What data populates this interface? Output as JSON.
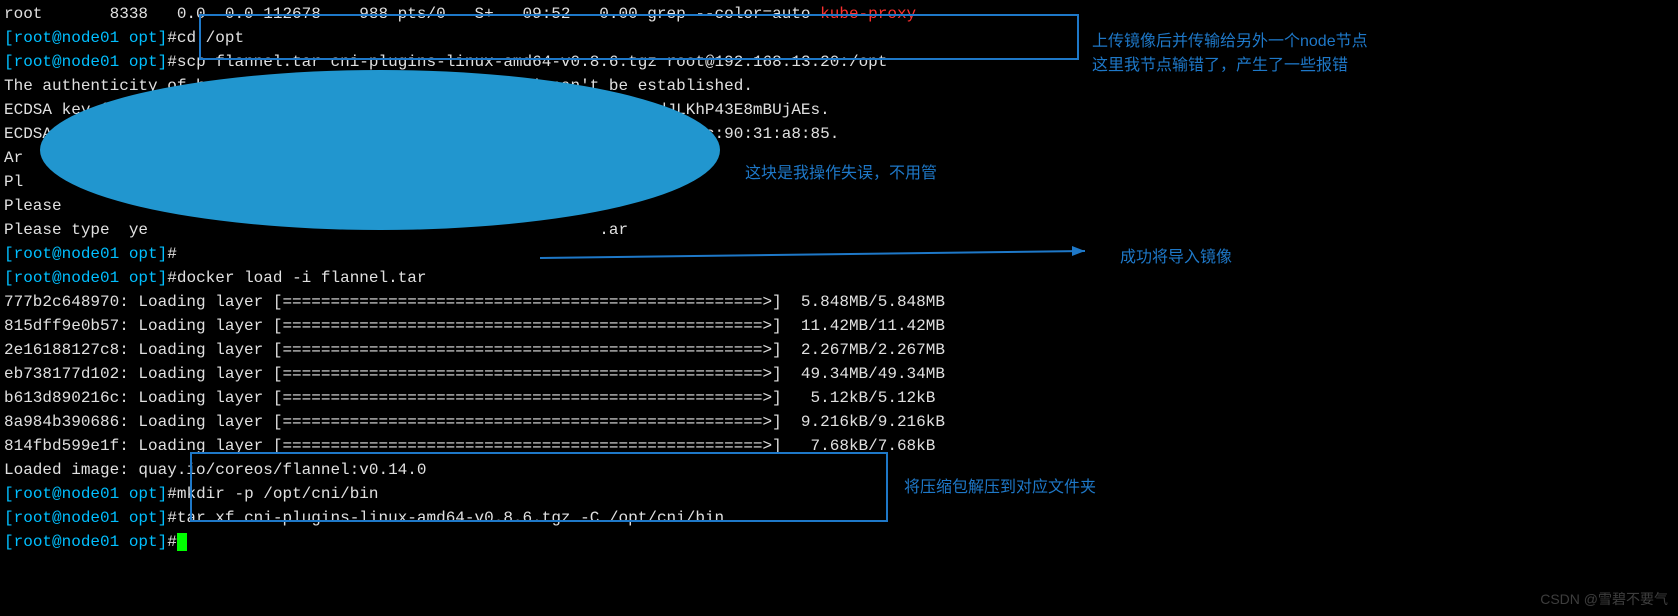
{
  "top_partial": {
    "left": "root       8338   0.0  0.0 112678    988 pts/0   S+   09:52   0.00 grep --color=auto ",
    "highlight": "kube-proxy"
  },
  "prompt": {
    "open": "[",
    "user": "root@node01 opt",
    "close": "]",
    "hash": "#"
  },
  "cmds": {
    "cd": "cd /opt",
    "scp": "scp flannel.tar cni-plugins-linux-amd64-v0.8.6.tgz root@192.168.13.20:/opt",
    "docker_load": "docker load -i flannel.tar",
    "mkdir": "mkdir -p /opt/cni/bin",
    "tar": "tar xf cni-plugins-linux-amd64-v0.8.6.tgz -C /opt/cni/bin"
  },
  "ssh": {
    "auth": "The authenticity of host '192.168.13.20 (192.168.13.20)' can't be established.",
    "ecdsa1": "ECDSA key fi                                                   58GbrdJLKhP43E8mBUjAEs.",
    "ecdsa2": "ECDSA                                                                  :bc:90:31:a8:85.",
    "ar": "Ar",
    "pl": "Pl",
    "please1": "Please",
    "please2": "Please type  ye                                               .ar"
  },
  "layers": [
    {
      "id": "777b2c648970",
      "label": "Loading layer",
      "bar": "[==================================================>]",
      "size": " 5.848MB/5.848MB"
    },
    {
      "id": "815dff9e0b57",
      "label": "Loading layer",
      "bar": "[==================================================>]",
      "size": " 11.42MB/11.42MB"
    },
    {
      "id": "2e16188127c8",
      "label": "Loading layer",
      "bar": "[==================================================>]",
      "size": " 2.267MB/2.267MB"
    },
    {
      "id": "eb738177d102",
      "label": "Loading layer",
      "bar": "[==================================================>]",
      "size": " 49.34MB/49.34MB"
    },
    {
      "id": "b613d890216c",
      "label": "Loading layer",
      "bar": "[==================================================>]",
      "size": "  5.12kB/5.12kB"
    },
    {
      "id": "8a984b390686",
      "label": "Loading layer",
      "bar": "[==================================================>]",
      "size": " 9.216kB/9.216kB"
    },
    {
      "id": "814fbd599e1f",
      "label": "Loading layer",
      "bar": "[==================================================>]",
      "size": "  7.68kB/7.68kB"
    }
  ],
  "loaded_image": "Loaded image: quay.io/coreos/flannel:v0.14.0",
  "annotations": {
    "upload1": "上传镜像后并传输给另外一个node节点",
    "upload2": "这里我节点输错了，产生了一些报错",
    "mistake": "这块是我操作失误，不用管",
    "success": "成功将导入镜像",
    "extract": "将压缩包解压到对应文件夹"
  },
  "watermark": "CSDN @雪碧不要气"
}
